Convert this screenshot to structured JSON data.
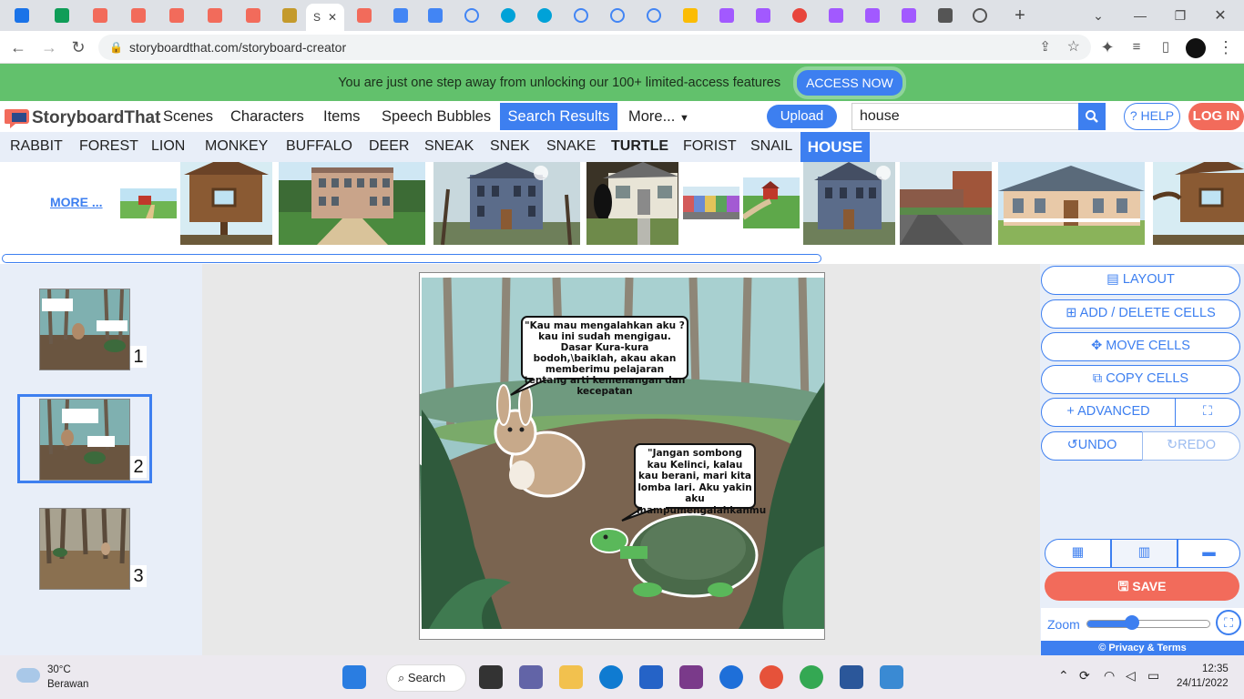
{
  "browser": {
    "active_tab_label": "S",
    "url": "storyboardthat.com/storyboard-creator"
  },
  "promo": {
    "text": "You are just one step away from unlocking our 100+ limited-access features",
    "button": "ACCESS NOW"
  },
  "header": {
    "logo": "StoryboardThat",
    "nav": [
      "Scenes",
      "Characters",
      "Items",
      "Speech Bubbles",
      "Search Results",
      "More..."
    ],
    "upload": "Upload",
    "search_value": "house",
    "help": "? HELP",
    "login": "LOG IN"
  },
  "keywords": [
    "RABBIT",
    "FOREST",
    "LION",
    "MONKEY",
    "BUFFALO",
    "DEER",
    "SNEAK",
    "SNEK",
    "SNAKE",
    "TURTLE",
    "FORIST",
    "SNAIL",
    "HOUSE"
  ],
  "thumbnails": {
    "more": "MORE ..."
  },
  "cells": [
    {
      "number": "1"
    },
    {
      "number": "2"
    },
    {
      "number": "3"
    }
  ],
  "canvas": {
    "bubble1": "\"Kau mau mengalahkan aku ? kau ini sudah mengigau. Dasar Kura-kura bodoh,\\baiklah, akau akan memberimu pelajaran tentang arti kemenangan dan kecepatan",
    "bubble2": "\"Jangan sombong kau Kelinci, kalau kau berani, mari kita lomba lari. Aku yakin aku mampumengalahkanmu"
  },
  "tools": {
    "layout": "LAYOUT",
    "add_delete": "ADD / DELETE CELLS",
    "move": "MOVE CELLS",
    "copy": "COPY CELLS",
    "advanced": "ADVANCED",
    "undo": "UNDO",
    "redo": "REDO",
    "save": "SAVE",
    "zoom": "Zoom",
    "zoom_level": 0.37,
    "privacy": "© Privacy & Terms"
  },
  "taskbar": {
    "weather_temp": "30°C",
    "weather_desc": "Berawan",
    "search": "Search",
    "time": "12:35",
    "date": "24/11/2022"
  },
  "colors": {
    "brand_blue": "#3d7ff0",
    "promo_green": "#62c16c",
    "save_red": "#f26b5b"
  }
}
